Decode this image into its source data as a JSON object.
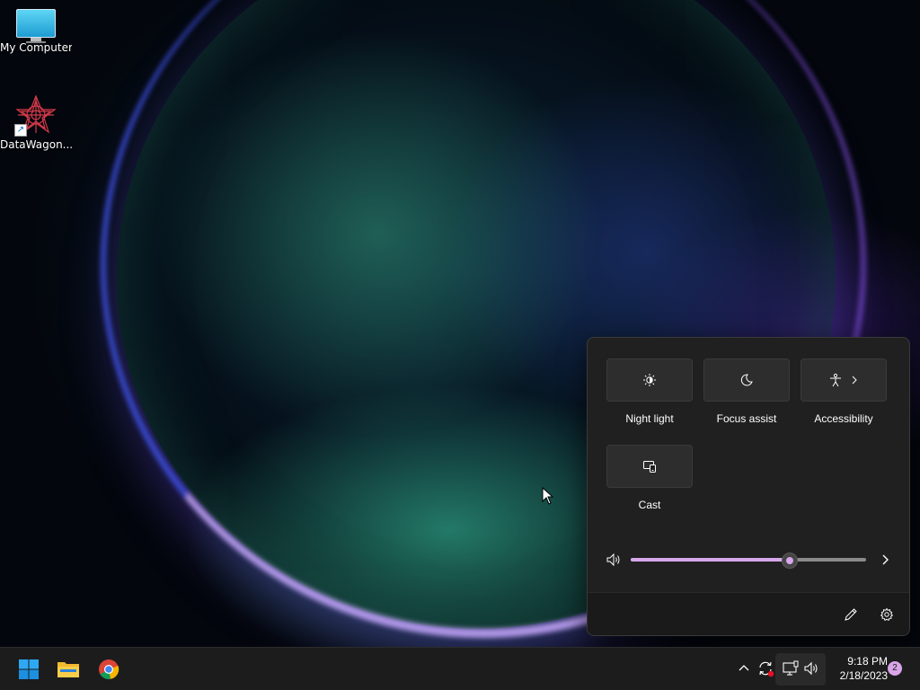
{
  "desktop": {
    "icons": [
      {
        "label": "My Computer",
        "icon": "computer-icon"
      },
      {
        "label": "DataWagon...",
        "icon": "datawagon-icon"
      }
    ]
  },
  "quick_settings": {
    "tiles": [
      {
        "label": "Night light",
        "icon": "night-light-icon"
      },
      {
        "label": "Focus assist",
        "icon": "moon-icon"
      },
      {
        "label": "Accessibility",
        "icon": "accessibility-icon",
        "has_chevron": true
      },
      {
        "label": "Cast",
        "icon": "cast-icon"
      }
    ],
    "volume": {
      "level_fraction": 0.67,
      "accent_color": "#d6a7ea"
    },
    "footer": {
      "edit_icon": "pencil-icon",
      "settings_icon": "gear-icon"
    }
  },
  "taskbar": {
    "apps": [
      {
        "name": "Start",
        "icon": "windows-logo-icon"
      },
      {
        "name": "File Explorer",
        "icon": "folder-icon"
      },
      {
        "name": "Google Chrome",
        "icon": "chrome-icon"
      }
    ],
    "tray_icons": [
      "chevron-up-icon",
      "sync-icon",
      "network-icon",
      "speaker-icon"
    ],
    "clock": {
      "time": "9:18 PM",
      "date": "2/18/2023"
    },
    "notification_count": "2"
  }
}
